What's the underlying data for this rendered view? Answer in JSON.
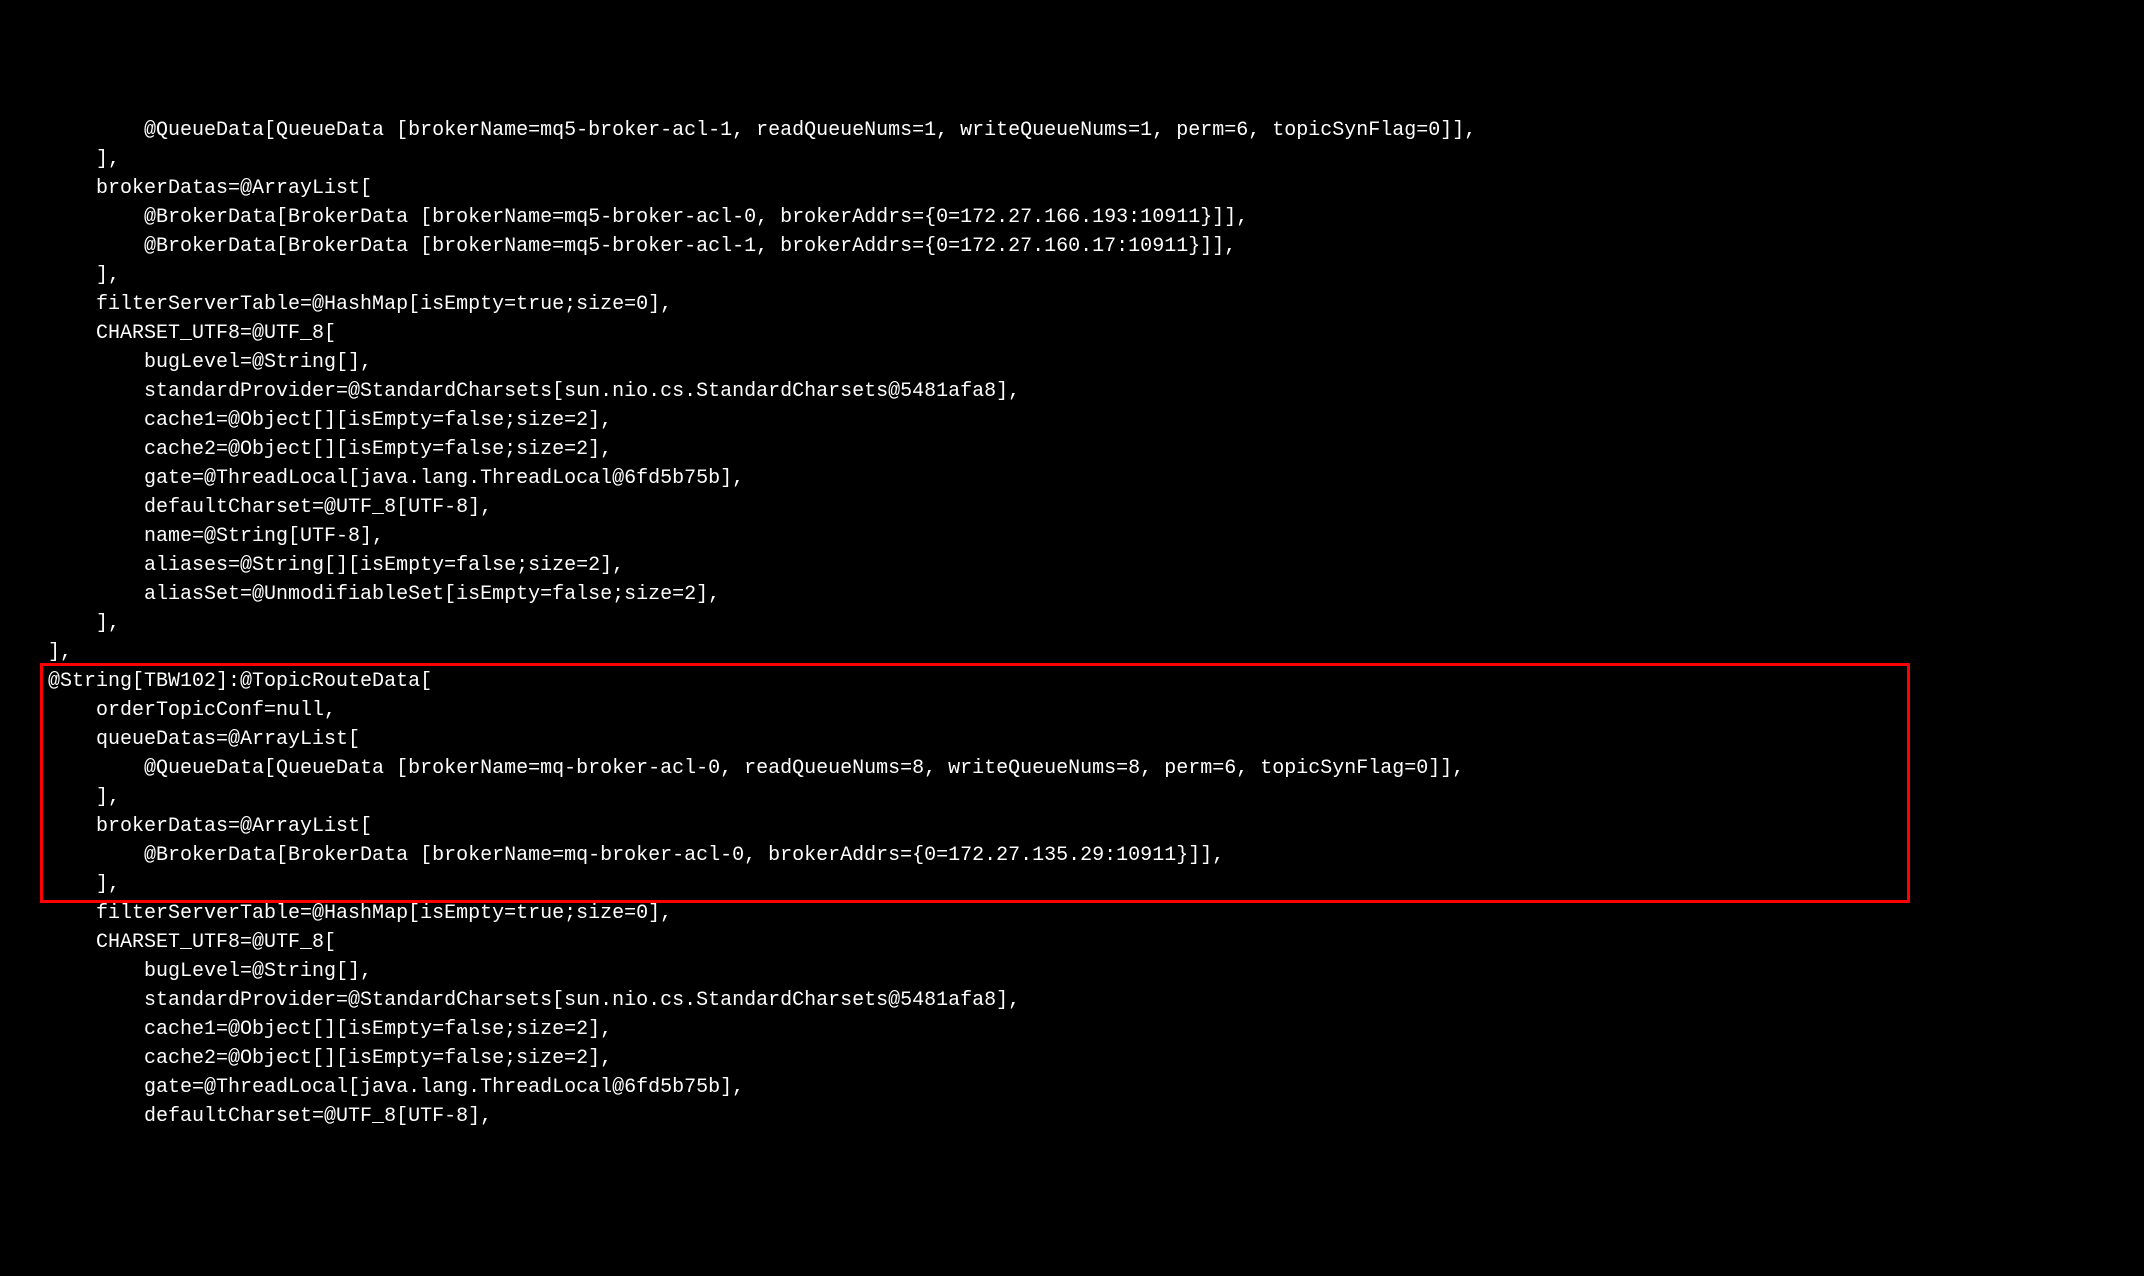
{
  "lines": [
    "            @QueueData[QueueData [brokerName=mq5-broker-acl-1, readQueueNums=1, writeQueueNums=1, perm=6, topicSynFlag=0]],",
    "        ],",
    "        brokerDatas=@ArrayList[",
    "            @BrokerData[BrokerData [brokerName=mq5-broker-acl-0, brokerAddrs={0=172.27.166.193:10911}]],",
    "            @BrokerData[BrokerData [brokerName=mq5-broker-acl-1, brokerAddrs={0=172.27.160.17:10911}]],",
    "        ],",
    "        filterServerTable=@HashMap[isEmpty=true;size=0],",
    "        CHARSET_UTF8=@UTF_8[",
    "            bugLevel=@String[],",
    "            standardProvider=@StandardCharsets[sun.nio.cs.StandardCharsets@5481afa8],",
    "            cache1=@Object[][isEmpty=false;size=2],",
    "            cache2=@Object[][isEmpty=false;size=2],",
    "            gate=@ThreadLocal[java.lang.ThreadLocal@6fd5b75b],",
    "            defaultCharset=@UTF_8[UTF-8],",
    "            name=@String[UTF-8],",
    "            aliases=@String[][isEmpty=false;size=2],",
    "            aliasSet=@UnmodifiableSet[isEmpty=false;size=2],",
    "        ],",
    "    ],",
    "    @String[TBW102]:@TopicRouteData[",
    "        orderTopicConf=null,",
    "        queueDatas=@ArrayList[",
    "            @QueueData[QueueData [brokerName=mq-broker-acl-0, readQueueNums=8, writeQueueNums=8, perm=6, topicSynFlag=0]],",
    "        ],",
    "        brokerDatas=@ArrayList[",
    "            @BrokerData[BrokerData [brokerName=mq-broker-acl-0, brokerAddrs={0=172.27.135.29:10911}]],",
    "        ],",
    "        filterServerTable=@HashMap[isEmpty=true;size=0],",
    "        CHARSET_UTF8=@UTF_8[",
    "            bugLevel=@String[],",
    "            standardProvider=@StandardCharsets[sun.nio.cs.StandardCharsets@5481afa8],",
    "            cache1=@Object[][isEmpty=false;size=2],",
    "            cache2=@Object[][isEmpty=false;size=2],",
    "            gate=@ThreadLocal[java.lang.ThreadLocal@6fd5b75b],",
    "            defaultCharset=@UTF_8[UTF-8],"
  ],
  "highlight": {
    "startLine": 19,
    "endLine": 26
  }
}
